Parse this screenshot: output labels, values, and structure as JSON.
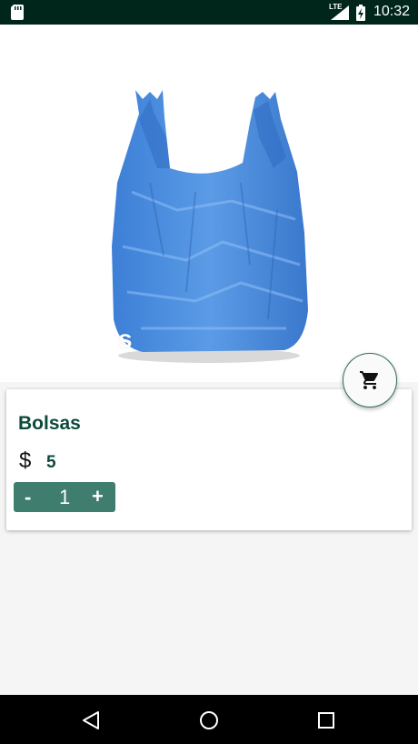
{
  "status_bar": {
    "network": "LTE",
    "time": "10:32"
  },
  "product": {
    "image_overlay_text": "s",
    "name": "Bolsas",
    "currency_symbol": "$",
    "price": "5",
    "quantity": "1",
    "decrement_label": "-",
    "increment_label": "+"
  },
  "icons": {
    "status": [
      "sd-card-icon",
      "signal-icon",
      "battery-charging-icon"
    ],
    "cart": "shopping-cart-icon",
    "navigation": [
      "back-icon",
      "home-icon",
      "recents-icon"
    ]
  },
  "colors": {
    "status_bar": "#00261c",
    "accent": "#0b4a3c",
    "stepper": "#3f7d6f",
    "bag": "#4f8fdc"
  }
}
